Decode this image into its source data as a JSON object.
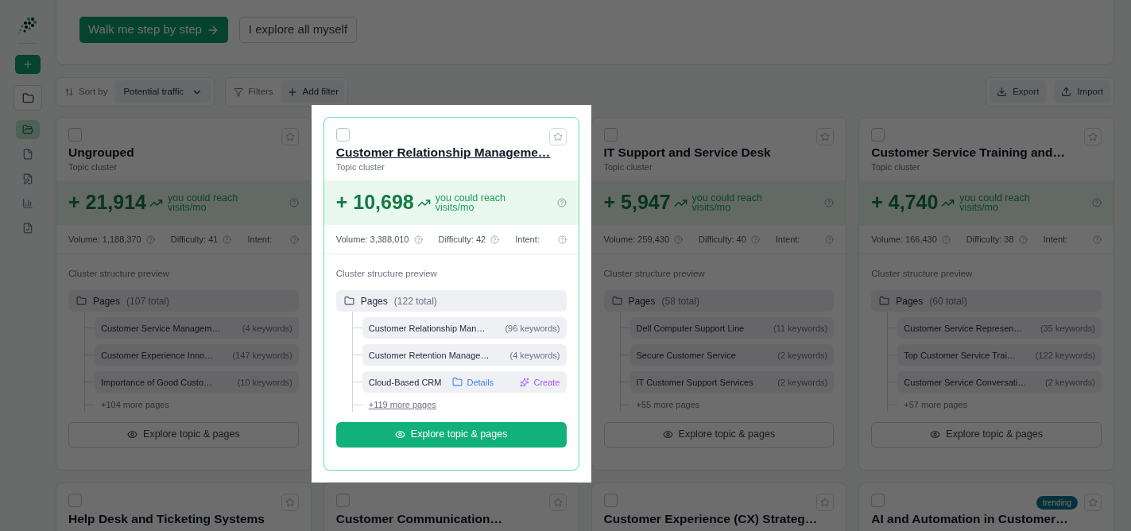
{
  "tour": {
    "buttons": [
      {
        "label": "Walk me step by step",
        "kind": "primary"
      },
      {
        "label": "I explore all myself",
        "kind": "secondary"
      }
    ]
  },
  "sidebar": {
    "items": [
      {
        "selected": true
      },
      {
        "selected": false
      },
      {
        "selected": false
      },
      {
        "selected": false
      },
      {
        "selected": false
      }
    ]
  },
  "toolbar": {
    "sort_label": "Sort by",
    "sort_value": "Potential traffic",
    "filters_label": "Filters",
    "add_filter": "Add filter",
    "export": "Export",
    "import": "Import"
  },
  "cards": [
    {
      "title": "Ungrouped",
      "subtitle": "Topic cluster",
      "highlighted": false,
      "checked": false,
      "traffic": "+ 21,914",
      "reach": "you could reach",
      "unit": "visits/mo",
      "volume": "Volume: 1,188,370",
      "difficulty": "Difficulty: 41",
      "intent": "Intent:",
      "preview_label": "Cluster structure preview",
      "pages_label": "Pages",
      "pages_total": "(107 total)",
      "pages": [
        {
          "kind": "page",
          "name": "Customer Service Managem…",
          "keywords": "(4 keywords)"
        },
        {
          "kind": "page",
          "name": "Customer Experience Inno…",
          "keywords": "(147 keywords)"
        },
        {
          "kind": "page",
          "name": "Importance of Good Custo…",
          "keywords": "(10 keywords)"
        }
      ],
      "more": "+104 more pages",
      "explore": "Explore topic & pages"
    },
    {
      "title": "Customer Relationship Manageme…",
      "subtitle": "Topic cluster",
      "highlighted": true,
      "checked": false,
      "traffic": "+ 10,698",
      "reach": "you could reach",
      "unit": "visits/mo",
      "volume": "Volume: 3,388,010",
      "difficulty": "Difficulty: 42",
      "intent": "Intent:",
      "preview_label": "Cluster structure preview",
      "pages_label": "Pages",
      "pages_total": "(122 total)",
      "pages": [
        {
          "kind": "page",
          "name": "Customer Relationship Man…",
          "keywords": "(96 keywords)"
        },
        {
          "kind": "page",
          "name": "Customer Retention Manage…",
          "keywords": "(4 keywords)"
        },
        {
          "kind": "hovered",
          "name": "Cloud-Based CRM",
          "details": "Details",
          "create": "Create"
        }
      ],
      "more": "+119 more pages",
      "explore": "Explore topic & pages"
    },
    {
      "title": "IT Support and Service Desk",
      "subtitle": "Topic cluster",
      "highlighted": false,
      "checked": false,
      "traffic": "+ 5,947",
      "reach": "you could reach",
      "unit": "visits/mo",
      "volume": "Volume: 259,430",
      "difficulty": "Difficulty: 40",
      "intent": "Intent:",
      "preview_label": "Cluster structure preview",
      "pages_label": "Pages",
      "pages_total": "(58 total)",
      "pages": [
        {
          "kind": "page",
          "name": "Dell Computer Support Line",
          "keywords": "(11 keywords)"
        },
        {
          "kind": "page",
          "name": "Secure Customer Service",
          "keywords": "(2 keywords)"
        },
        {
          "kind": "page",
          "name": "IT Customer Support Services",
          "keywords": "(2 keywords)"
        }
      ],
      "more": "+55 more pages",
      "explore": "Explore topic & pages"
    },
    {
      "title": "Customer Service Training and…",
      "subtitle": "Topic cluster",
      "highlighted": false,
      "checked": false,
      "traffic": "+ 4,740",
      "reach": "you could reach",
      "unit": "visits/mo",
      "volume": "Volume: 166,430",
      "difficulty": "Difficulty: 38",
      "intent": "Intent:",
      "preview_label": "Cluster structure preview",
      "pages_label": "Pages",
      "pages_total": "(60 total)",
      "pages": [
        {
          "kind": "page",
          "name": "Customer Service Represen…",
          "keywords": "(35 keywords)"
        },
        {
          "kind": "page",
          "name": "Top Customer Service Trai…",
          "keywords": "(122 keywords)"
        },
        {
          "kind": "page",
          "name": "Customer Service Conversati…",
          "keywords": "(2 keywords)"
        }
      ],
      "more": "+57 more pages",
      "explore": "Explore topic & pages"
    }
  ],
  "more_cards": [
    {
      "title": "Help Desk and Ticketing Systems",
      "checked": false
    },
    {
      "title": "Customer Communication…",
      "checked": false
    },
    {
      "title": "Customer Experience (CX) Strateg…",
      "checked": false
    },
    {
      "title": "AI and Automation in Customer…",
      "checked": false,
      "badge": "trending"
    }
  ]
}
